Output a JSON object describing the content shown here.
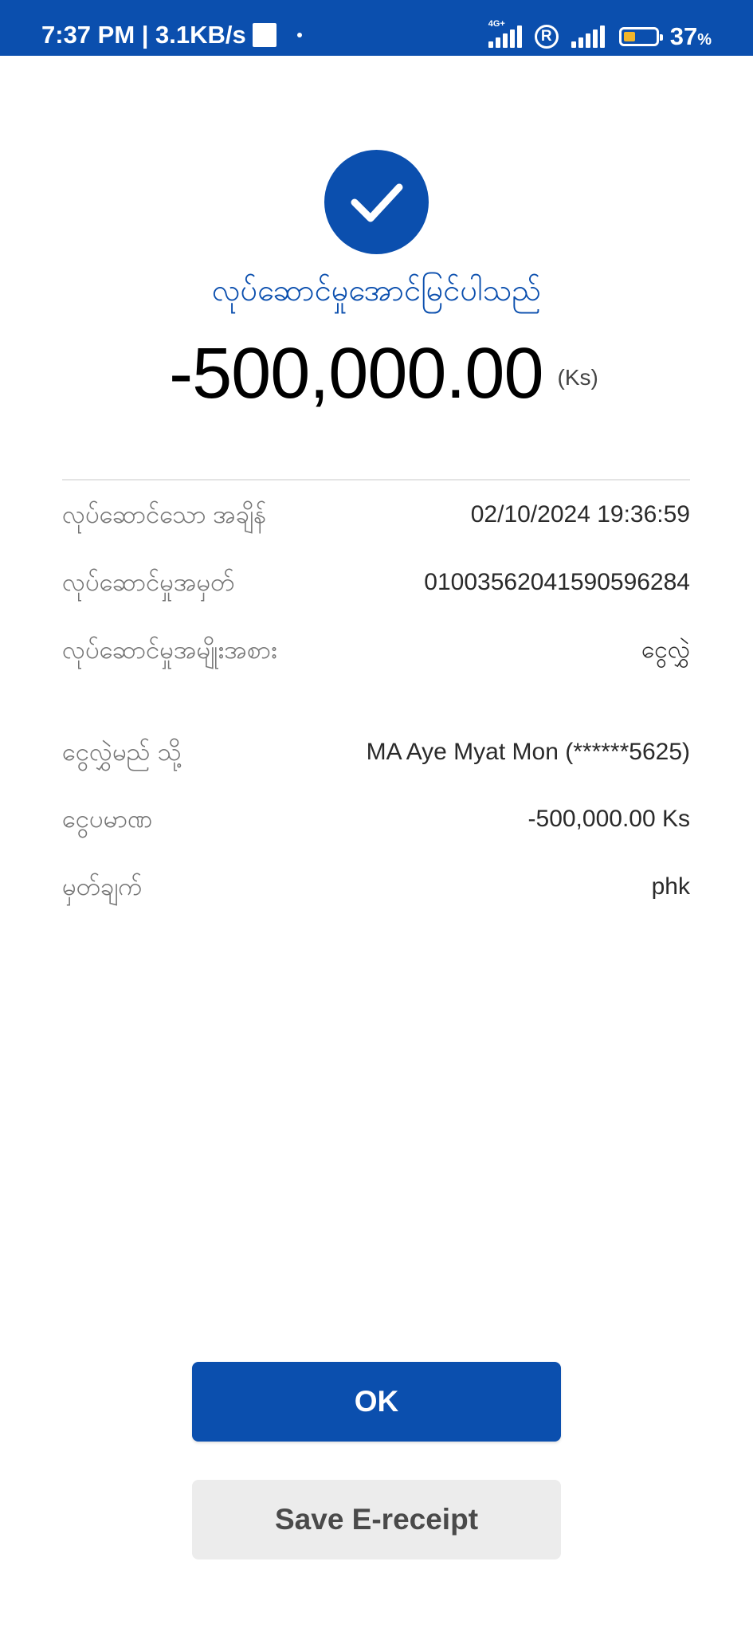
{
  "status_bar": {
    "time_speed": "7:37 PM | 3.1KB/s",
    "network_type": "4G+",
    "battery_percent": "37",
    "battery_unit": "%",
    "battery_level": 0.37,
    "roaming_symbol": "R",
    "battery_color": "#f0b52b"
  },
  "header": {
    "icon": "check-icon",
    "success_message": "လုပ်ဆောင်မှုအောင်မြင်ပါသည်",
    "amount": "-500,000.00",
    "currency": "(Ks)"
  },
  "details": [
    {
      "label": "လုပ်ဆောင်သော အချိန်",
      "value": "02/10/2024 19:36:59"
    },
    {
      "label": "လုပ်ဆောင်မှုအမှတ်",
      "value": "01003562041590596284"
    },
    {
      "label": "လုပ်ဆောင်မှုအမျိုးအစား",
      "value": "ငွေလွှဲ"
    },
    {
      "label": "ငွေလွှဲမည် သို့",
      "value": "MA Aye Myat Mon (******5625)"
    },
    {
      "label": "ငွေပမာဏ",
      "value": "-500,000.00 Ks"
    },
    {
      "label": "မှတ်ချက်",
      "value": "phk"
    }
  ],
  "actions": {
    "ok_label": "OK",
    "save_label": "Save E-receipt"
  },
  "colors": {
    "primary": "#0b4fae",
    "secondary_button": "#ececec"
  }
}
